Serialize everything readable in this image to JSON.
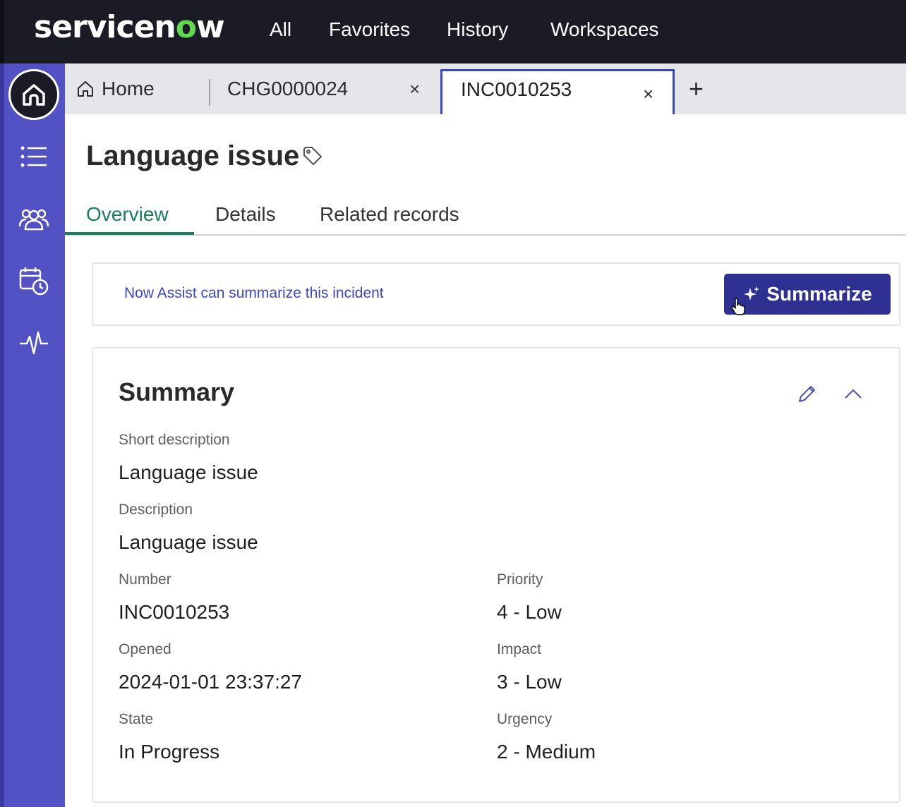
{
  "app": {
    "brand": "servicenow",
    "brand_colors": {
      "topbar": "#1a1b24",
      "sidebar": "#5352c4",
      "accent": "#62d84e",
      "primary_button": "#2e3192",
      "tab_active": "#1a7f5a"
    }
  },
  "topnav": {
    "items": [
      {
        "label": "All"
      },
      {
        "label": "Favorites"
      },
      {
        "label": "History"
      },
      {
        "label": "Workspaces"
      }
    ]
  },
  "sidebar": {
    "icons": [
      "home-icon",
      "list-icon",
      "groups-icon",
      "calendar-clock-icon",
      "activity-icon"
    ]
  },
  "tabs": {
    "home_label": "Home",
    "items": [
      {
        "label": "CHG0000024",
        "close": "×"
      },
      {
        "label": "INC0010253",
        "close": "×"
      }
    ],
    "add": "+"
  },
  "record": {
    "title": "Language issue",
    "tabs": [
      {
        "label": "Overview"
      },
      {
        "label": "Details"
      },
      {
        "label": "Related records"
      }
    ]
  },
  "assist": {
    "text": "Now Assist can summarize this incident",
    "button_label": "Summarize"
  },
  "summary": {
    "title": "Summary",
    "short_description_label": "Short description",
    "short_description_value": "Language issue",
    "description_label": "Description",
    "description_value": "Language issue",
    "number_label": "Number",
    "number_value": "INC0010253",
    "priority_label": "Priority",
    "priority_value": "4 - Low",
    "opened_label": "Opened",
    "opened_value": "2024-01-01 23:37:27",
    "impact_label": "Impact",
    "impact_value": "3 - Low",
    "state_label": "State",
    "state_value": "In Progress",
    "urgency_label": "Urgency",
    "urgency_value": "2 - Medium"
  }
}
